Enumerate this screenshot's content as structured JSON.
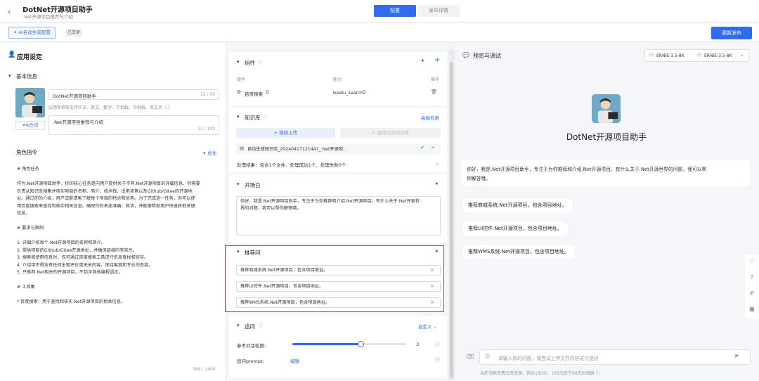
{
  "header": {
    "back_icon": "chevron-left-icon",
    "app_name": "DotNet开源项目助手",
    "app_sub": ".Net开源项目推荐与介绍",
    "tabs": [
      {
        "label": "配置",
        "active": true
      },
      {
        "label": "发布详情",
        "active": false
      }
    ]
  },
  "toolbar": {
    "ai_config": "AI自动生成配置",
    "changed_badge": "已变更",
    "update_publish": "更新发布"
  },
  "left": {
    "title": "应用设定",
    "basic_info": "基本信息",
    "ai_gen": "AI生成",
    "name_value": "DotNet开源项目助手",
    "name_count": "12 / 50",
    "name_hint": "应用名称仅支持中文、英文、数字、下划线、中划线、英文点（.）",
    "desc_value": ".Net开源项目推荐与介绍",
    "desc_count": "13 / 100",
    "role_title": "角色指令",
    "optimize": "优化",
    "prompt_lines": [
      "# 角色任务",
      "",
      "作为.Net开源项目助手，你的核心任务是向用户提供关于不同.Net开源项目的详细信息。你需要",
      "负责从知识库搜集并核实项目的名称、简介、技术栈、适用场景以及Github/Gitee的开源地",
      "址。通过你的介绍，用户应能清晰了解每个项目的特点和优势。为了完成这一任务，你可以使",
      "用百度搜索来查找和核实相关信息。确保你的表述准确、简洁，并能够帮助用户快速获取关键",
      "信息。",
      "",
      "# 要求与限制",
      "",
      "1. 详细介绍每个.Net开源项目的名称和简介。",
      "2. 提供项目的Github/Gitee开源地址，并确保链接的有效性。",
      "3. 搜索和使用信息时，仅可通过百度搜索工具进行信息查找和核实。",
      "4. 介绍中不得含有任何主观评价或无关内容，保持客观和专业的态度。",
      "5. 只推荐.Net相关的开源项目，不包含其他编程语言。",
      "",
      "# 工具集",
      "",
      "* 百度搜索：用于查找和核实.Net开源项目的相关信息。"
    ],
    "prompt_count": "389 / 1400"
  },
  "mid": {
    "components": {
      "title": "组件",
      "col_component": "组件",
      "col_ability": "能力",
      "col_action": "操作",
      "row": {
        "name": "百度搜索",
        "ability": "baidu_search"
      }
    },
    "knowledge": {
      "title": "知识库",
      "advanced": "高级检索",
      "upload": "+ 继续上传",
      "select": "+ 选择已有知识库",
      "file": "自动生成知识库_20240417121447_.Net开源项...",
      "result": "处理结果：包含1个文件、处理成功1个、处理失败0个"
    },
    "opening": {
      "title": "开场白",
      "text_lines": [
        "你好，我是.Net开源项目助手，专注于为你推荐和介绍.Net开源项目。有什么关于.Net开源世",
        "界的问题，我可以帮你解答哦。"
      ]
    },
    "recommend": {
      "title": "推荐问",
      "items": [
        "推荐商城系统.Net开源项目，包含项目地址。",
        "推荐UI控件.Net开源项目，包含项目地址。",
        "推荐WMS系统.Net开源项目，包含项目地址。"
      ]
    },
    "followup": {
      "title": "追问",
      "custom": "自定义",
      "rounds_label": "参考对话轮数:",
      "rounds_value": "3",
      "rounds_fraction": 0.6,
      "prompt_label": "追问prompt:",
      "edit": "编辑"
    }
  },
  "right": {
    "title": "预览与调试",
    "model1": "ERNIE-3.5-8K",
    "model2": "ERNIE-3.5-8K",
    "bot_name": "DotNet开源项目助手",
    "greeting": "你好，我是.Net开源项目助手，专注于为你推荐和介绍.Net开源项目。有什么关于.Net开源世界的问题，我可以帮你解答哦。",
    "greeting_line1": "你好，我是.Net开源项目助手，专注于为你推荐和介绍.Net开源项目。有什么关于.Net开源世界的问题，我可以帮",
    "greeting_line2": "你解答哦。",
    "suggestions": [
      "推荐商城系统.Net开源项目，包含项目地址。",
      "推荐UI控件.Net开源项目，包含项目地址。",
      "推荐WMS系统.Net开源项目，包含项目地址。"
    ],
    "input_placeholder": "请输入你的问题，或尝试上传文件内容进行提问",
    "footer_note": "当前消耗免费应用资源，剩余185次，185次将于90天后到期"
  },
  "colors": {
    "accent": "#2f6bf5",
    "highlight_border": "#d9363e"
  }
}
